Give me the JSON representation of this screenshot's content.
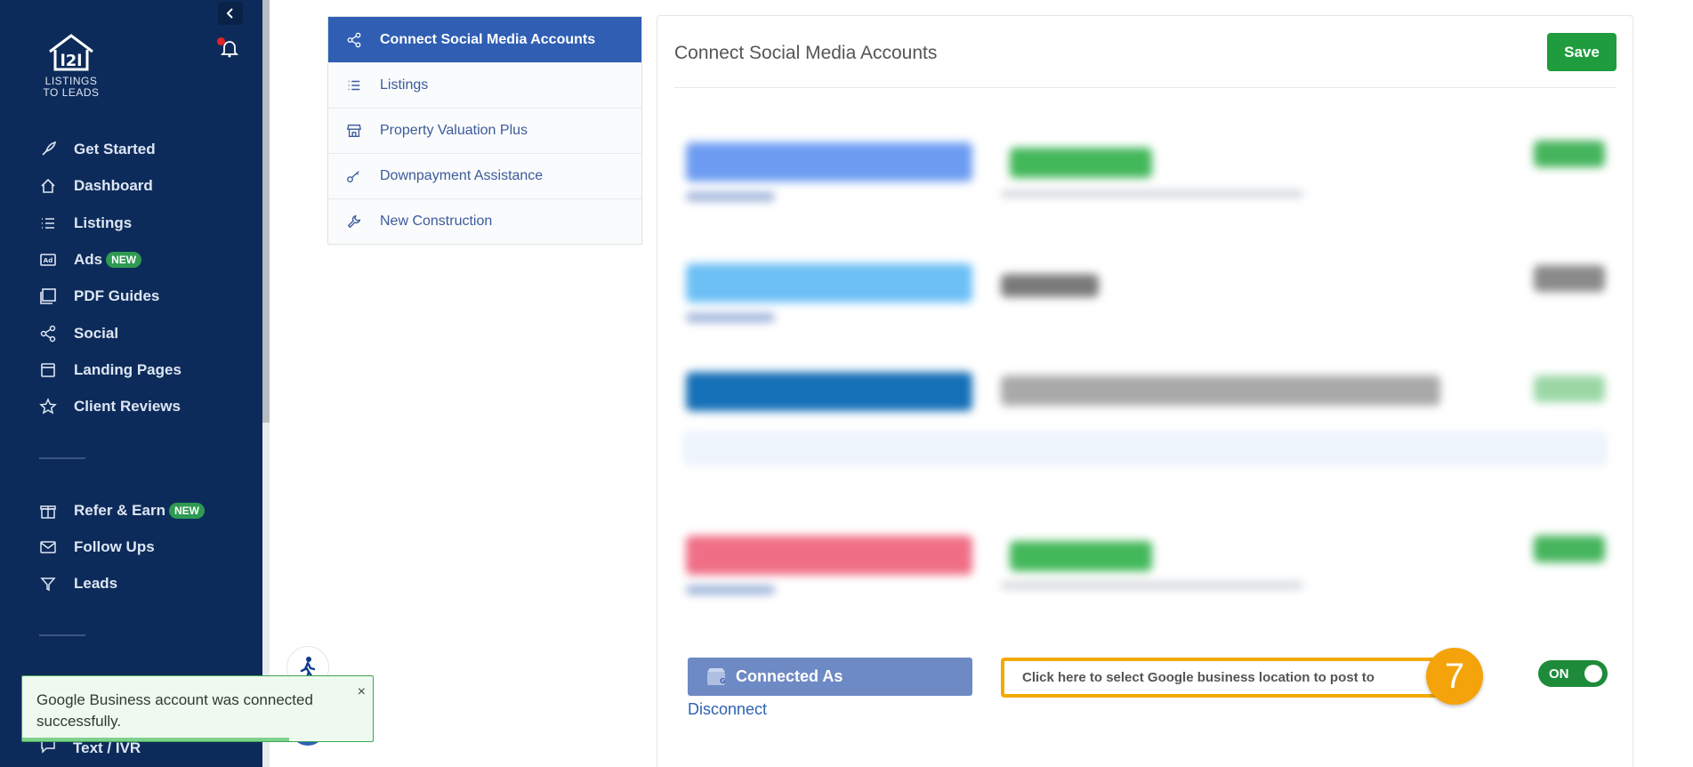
{
  "sidebar": {
    "logo_lines": [
      "LISTINGS",
      "TO LEADS"
    ],
    "items": [
      {
        "label": "Get Started",
        "icon": "rocket-icon"
      },
      {
        "label": "Dashboard",
        "icon": "home-icon"
      },
      {
        "label": "Listings",
        "icon": "list-icon"
      },
      {
        "label": "Ads",
        "icon": "ad-icon",
        "badge": "NEW"
      },
      {
        "label": "PDF Guides",
        "icon": "pdf-icon"
      },
      {
        "label": "Social",
        "icon": "share-icon"
      },
      {
        "label": "Landing Pages",
        "icon": "page-icon"
      },
      {
        "label": "Client Reviews",
        "icon": "star-icon"
      },
      {
        "label": "Refer & Earn",
        "icon": "gift-icon",
        "badge": "NEW"
      },
      {
        "label": "Follow Ups",
        "icon": "mail-icon"
      },
      {
        "label": "Leads",
        "icon": "filter-icon"
      },
      {
        "label": "Text / IVR",
        "icon": "chat-icon"
      }
    ]
  },
  "settings_nav": {
    "items": [
      {
        "label": "Connect Social Media Accounts",
        "icon": "share-icon",
        "active": true
      },
      {
        "label": "Listings",
        "icon": "list-icon"
      },
      {
        "label": "Property Valuation Plus",
        "icon": "store-icon"
      },
      {
        "label": "Downpayment Assistance",
        "icon": "key-icon"
      },
      {
        "label": "New Construction",
        "icon": "wrench-icon"
      }
    ]
  },
  "main": {
    "title": "Connect Social Media Accounts",
    "save_label": "Save",
    "google": {
      "connected_label": "Connected As",
      "disconnect_label": "Disconnect",
      "location_placeholder": "Click here to select Google business location to post to",
      "toggle_label": "ON",
      "step_number": "7"
    }
  },
  "toast": {
    "message": "Google Business account was connected successfully.",
    "close_label": "×"
  },
  "colors": {
    "sidebar_bg": "#0d2b5a",
    "active_nav": "#2f5eb3",
    "save_green": "#1e9c3e",
    "step_orange": "#f5a30a",
    "highlight_border": "#f2a900"
  }
}
